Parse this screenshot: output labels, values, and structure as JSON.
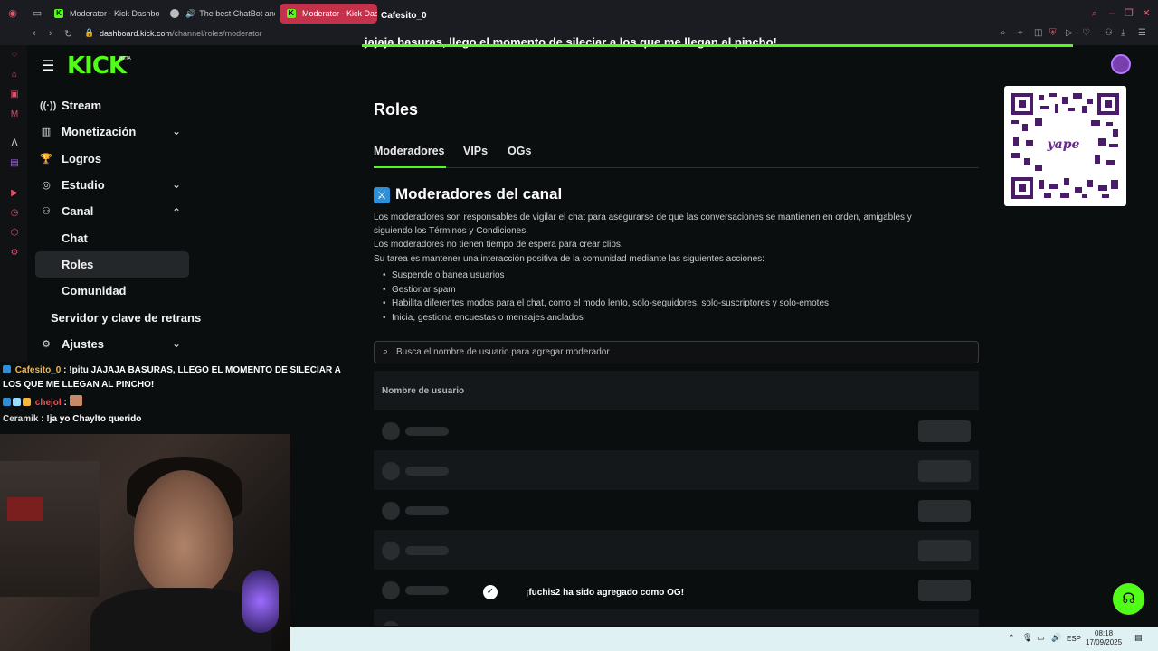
{
  "browser": {
    "tabs": [
      {
        "label": "Moderator - Kick Dashbo",
        "icon": "kick-favicon"
      },
      {
        "label": "The best ChatBot and",
        "icon": "chatbot-favicon"
      },
      {
        "label": "Moderator - Kick Dash",
        "icon": "kick-favicon"
      }
    ],
    "url_host": "dashboard.kick.com",
    "url_path": "/channel/roles/moderator"
  },
  "overlay": {
    "user": "Cafesito_0",
    "message": "jajaja basuras, llego el momento de sileciar a los que me llegan al pincho!"
  },
  "header": {
    "logo": "KICK",
    "beta": "BETA"
  },
  "sidebar": {
    "items": [
      {
        "label": "Stream",
        "icon": "stream-icon"
      },
      {
        "label": "Monetización",
        "icon": "monetization-icon"
      },
      {
        "label": "Logros",
        "icon": "trophy-icon"
      },
      {
        "label": "Estudio",
        "icon": "studio-icon"
      },
      {
        "label": "Canal",
        "icon": "channel-icon"
      },
      {
        "label": "Chat"
      },
      {
        "label": "Roles"
      },
      {
        "label": "Comunidad"
      },
      {
        "label": "Servidor y clave de retrans"
      },
      {
        "label": "Ajustes",
        "icon": "gear-icon"
      }
    ]
  },
  "main": {
    "title": "Roles",
    "tabs": [
      "Moderadores",
      "VIPs",
      "OGs"
    ],
    "section_title": "Moderadores del canal",
    "paragraphs": [
      "Los moderadores son responsables de vigilar el chat para asegurarse de que las conversaciones se mantienen en orden, amigables y",
      "siguiendo los Términos y Condiciones.",
      "Los moderadores no tienen tiempo de espera para crear clips.",
      "Su tarea es mantener una interacción positiva de la comunidad mediante las siguientes acciones:"
    ],
    "bullets": [
      "Suspende o banea usuarios",
      "Gestionar spam",
      "Habilita diferentes modos para el chat, como el modo lento, solo-seguidores, solo-suscriptores y solo-emotes",
      "Inicia, gestiona encuestas o mensajes anclados"
    ],
    "search_placeholder": "Busca el nombre de usuario para agregar moderador",
    "table_header": "Nombre de usuario",
    "toast": "¡fuchis2 ha sido agregado como OG!"
  },
  "qr": {
    "brand": "yape"
  },
  "chat": [
    {
      "user": "Cafesito_0",
      "text": ": !pitu JAJAJA BASURAS, LLEGO EL MOMENTO DE SILECIAR A",
      "cont": "LOS QUE ME LLEGAN AL PINCHO!"
    },
    {
      "user": "chejol",
      "text": ":"
    },
    {
      "user": "Ceramik",
      "text": ": !ja yo Chaylto querido"
    }
  ],
  "taskbar": {
    "lang": "ESP",
    "time": "08:18",
    "date": "17/09/2025"
  },
  "colors": {
    "accent": "#53fc18",
    "background": "#0b0e0f"
  }
}
